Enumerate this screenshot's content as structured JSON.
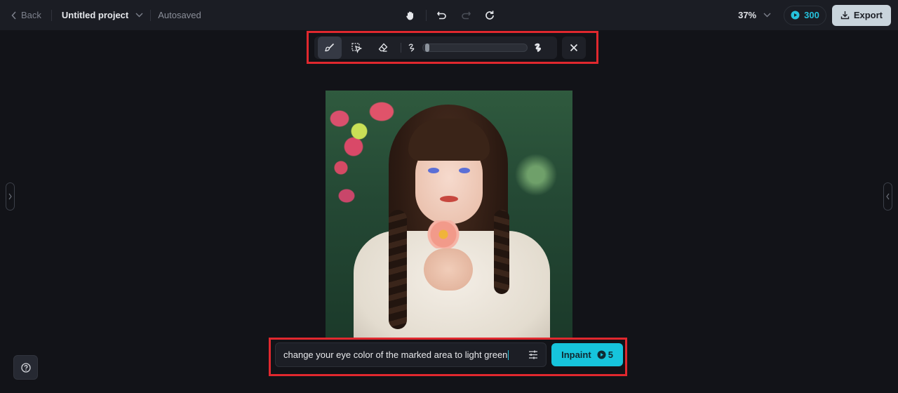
{
  "header": {
    "back_label": "Back",
    "project_name": "Untitled project",
    "save_status": "Autosaved",
    "zoom_level": "37%",
    "credits": "300",
    "export_label": "Export",
    "icons": [
      "chevron-left-icon",
      "chevron-down-icon",
      "hand-pan-icon",
      "undo-icon",
      "redo-icon",
      "refresh-icon",
      "credit-coin-icon",
      "download-icon"
    ]
  },
  "toolbar": {
    "tools": [
      {
        "name": "brush",
        "icon": "brush-icon",
        "active": true
      },
      {
        "name": "smart-select",
        "icon": "smart-select-icon",
        "active": false
      },
      {
        "name": "eraser",
        "icon": "eraser-icon",
        "active": false
      }
    ],
    "brush_size": {
      "min_icon": "thin-stroke-icon",
      "max_icon": "thick-stroke-icon",
      "value_fraction": 0.02
    },
    "close_icon": "close-icon"
  },
  "canvas": {
    "image_description": "Portrait of a young woman with braided dark hair and blue eyes holding a pink flower, wearing a white puff-sleeve dress, green bokeh background with pink flowers"
  },
  "side_panels": {
    "left_toggle_icon": "chevron-right-icon",
    "right_toggle_icon": "chevron-left-icon"
  },
  "help": {
    "icon": "help-circle-icon"
  },
  "prompt": {
    "value": "change your eye color of the marked area to light green",
    "settings_icon": "sliders-icon"
  },
  "inpaint": {
    "label": "Inpaint",
    "cost": "5",
    "cost_icon": "credit-coin-icon"
  },
  "colors": {
    "accent": "#16c4dc",
    "highlight_box": "#e0282e",
    "background": "#121318",
    "topbar": "#1b1d24"
  }
}
